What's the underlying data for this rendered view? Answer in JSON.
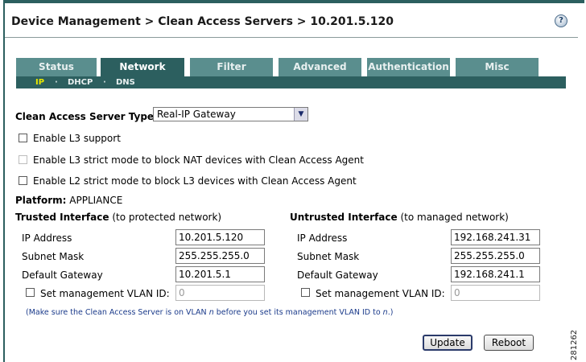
{
  "breadcrumb": "Device Management > Clean Access Servers > 10.201.5.120",
  "help_icon": "help-icon",
  "tabs": [
    {
      "label": "Status",
      "active": false
    },
    {
      "label": "Network",
      "active": true
    },
    {
      "label": "Filter",
      "active": false
    },
    {
      "label": "Advanced",
      "active": false
    },
    {
      "label": "Authentication",
      "active": false
    },
    {
      "label": "Misc",
      "active": false
    }
  ],
  "subtabs": [
    {
      "label": "IP",
      "active": true
    },
    {
      "label": "DHCP",
      "active": false
    },
    {
      "label": "DNS",
      "active": false
    }
  ],
  "subtab_separator": "·",
  "server_type": {
    "label": "Clean Access Server Type:",
    "value": "Real-IP Gateway"
  },
  "options": {
    "l3_support": "Enable L3 support",
    "l3_strict": "Enable L3 strict mode to block NAT devices with Clean Access Agent",
    "l2_strict": "Enable L2 strict mode to block L3 devices with Clean Access Agent"
  },
  "platform": {
    "label": "Platform:",
    "value": "APPLIANCE"
  },
  "trusted": {
    "heading": "Trusted Interface",
    "subheading": "(to protected network)",
    "ip_label": "IP Address",
    "ip_value": "10.201.5.120",
    "mask_label": "Subnet Mask",
    "mask_value": "255.255.255.0",
    "gateway_label": "Default Gateway",
    "gateway_value": "10.201.5.1",
    "vlan_label": "Set management VLAN ID:",
    "vlan_value": "0"
  },
  "untrusted": {
    "heading": "Untrusted Interface",
    "subheading": "(to managed network)",
    "ip_label": "IP Address",
    "ip_value": "192.168.241.31",
    "mask_label": "Subnet Mask",
    "mask_value": "255.255.255.0",
    "gateway_label": "Default Gateway",
    "gateway_value": "192.168.241.1",
    "vlan_label": "Set management VLAN ID:",
    "vlan_value": "0"
  },
  "note": {
    "part1": "(Make sure the Clean Access Server is on VLAN ",
    "n1": "n",
    "part2": " before you set its management VLAN ID to ",
    "n2": "n",
    "part3": ".)"
  },
  "buttons": {
    "update": "Update",
    "reboot": "Reboot"
  },
  "figure_number": "281262",
  "colors": {
    "tab": "#5a8e8e",
    "tab_active": "#2c5f5f",
    "subtab_selected": "#e8e800",
    "note": "#1a3a8a"
  }
}
